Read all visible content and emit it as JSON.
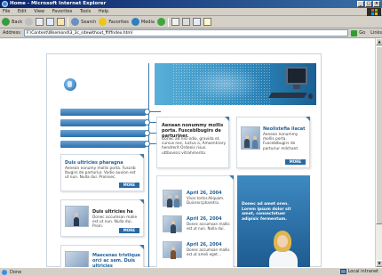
{
  "window": {
    "title": "Home - Microsoft Internet Explorer",
    "controls": [
      "_",
      "□",
      "×"
    ]
  },
  "menu": [
    "File",
    "Edit",
    "View",
    "Favorites",
    "Tools",
    "Help"
  ],
  "toolbar": {
    "back": "Back",
    "search": "Search",
    "favorites": "Favorites",
    "media": "Media"
  },
  "address": {
    "label": "Address",
    "url": "F:\\Content\\Wsemond\\3_3c_sitewithout_ff\\ffndex.html",
    "go": "Go",
    "links": "Links"
  },
  "status": {
    "text": "Done",
    "zone": "Local intranet"
  },
  "site": {
    "intro": {
      "title": "Aenean nonummy mollis porta. Fusceblbugirs de parturiner.",
      "text": "Donec ad nisi odio, gravida et, cursus nec, luctus a, Amoentnary hendrerit Ordenis risus. uttbovissi vitrahmerito."
    },
    "feature": {
      "title": "Neolistefia ilacat",
      "text": "Aenean nonummy mollis porta. Fusceblbugirs de parturiur milchant.",
      "more": "MORE"
    },
    "left_cards": [
      {
        "title": "Duis ultricies pharagna",
        "text": "Aenean nonumy mollis porta. Fusceb lbugirs de parturiur. Vodio auvion est ut nun. Nulla dui. Proinsec.",
        "more": "MORE"
      },
      {
        "title": "Duis ultricies ha",
        "text": "Donec accumsan malie est ut nun. Nulla dui. Proin.",
        "more": "MORE"
      },
      {
        "title": "Maecenas tristique orci ac sem. Duis ultricies",
        "text": "",
        "more": ""
      }
    ],
    "news": [
      {
        "date": "April 26, 2004",
        "text": "Vivar tortor.Aliquam. Duicenrcpharetra."
      },
      {
        "date": "April 26, 2004",
        "text": "Donec accumsan mallis est ut nun. Nulla dui."
      },
      {
        "date": "April 26, 2004",
        "text": "Donec accumsan mallis est ut ameli eget..."
      }
    ],
    "promo": {
      "text": "Donec ad amet oren. Lorem ipsum dolor sit amet, consectetuer adipisic fermentum."
    }
  }
}
